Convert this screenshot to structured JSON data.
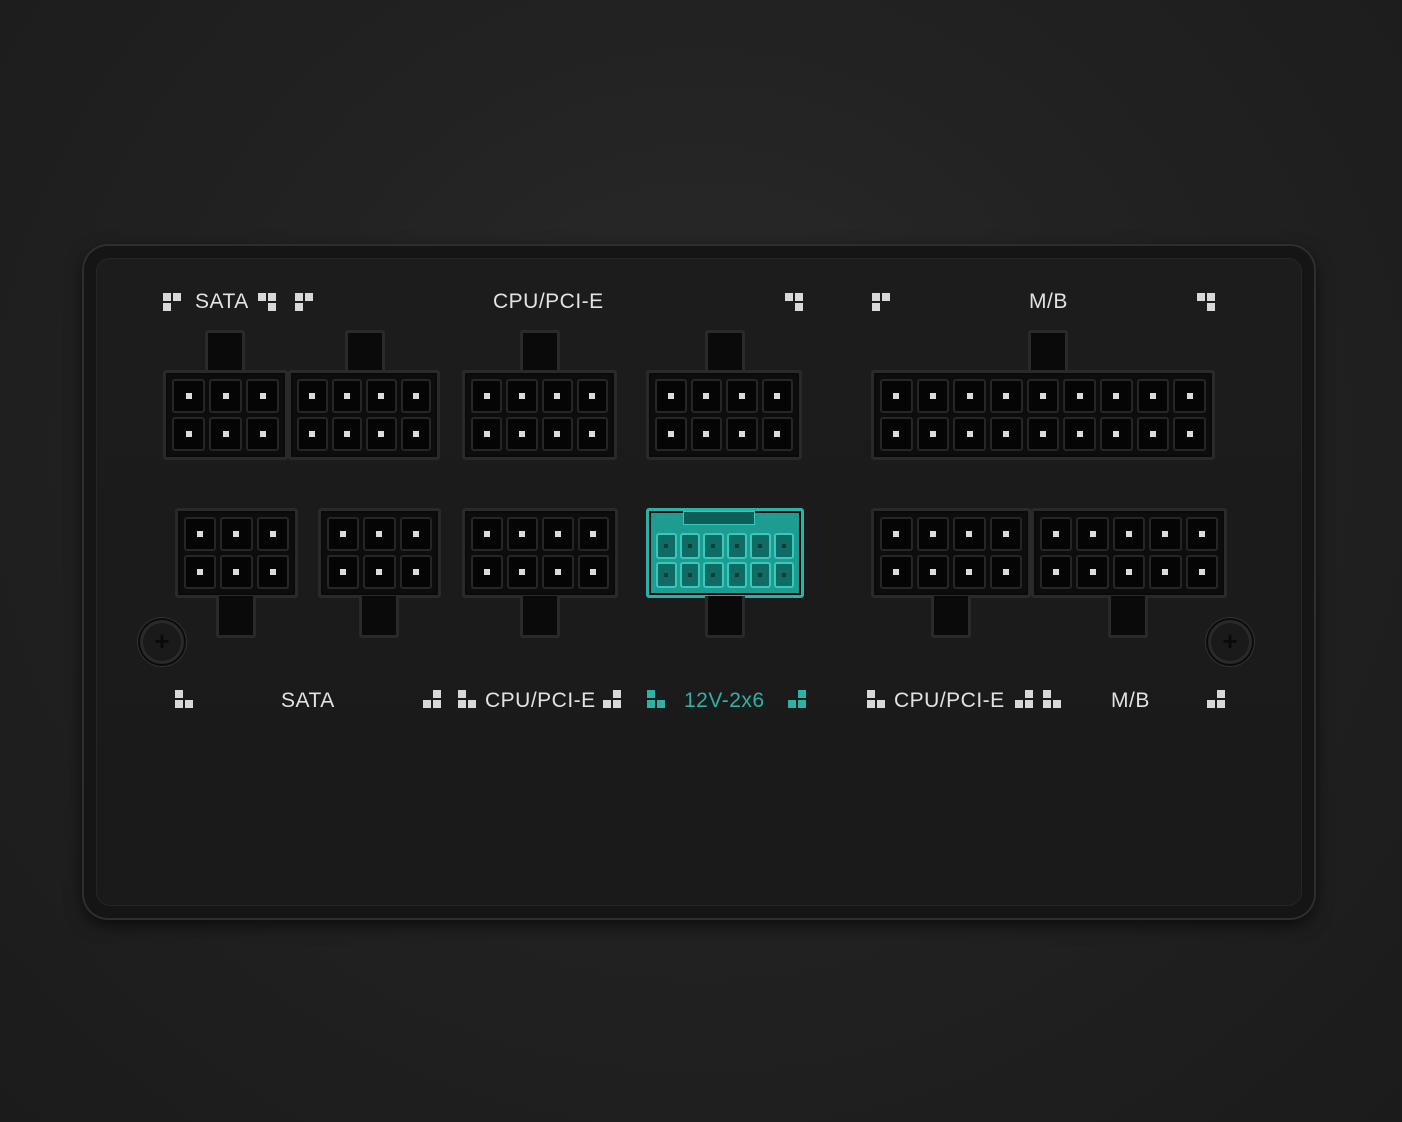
{
  "labels": {
    "top_sata": "SATA",
    "top_cpu_pcie": "CPU/PCI-E",
    "top_mb": "M/B",
    "bottom_sata": "SATA",
    "bottom_cpu_pcie_1": "CPU/PCI-E",
    "bottom_12v": "12V-2x6",
    "bottom_cpu_pcie_2": "CPU/PCI-E",
    "bottom_mb": "M/B"
  },
  "colors": {
    "accent": "#2bb3a8",
    "label": "#e2e2e2",
    "panel": "#1a1a1a"
  },
  "icons": {
    "screw": "phillips-screw-icon"
  }
}
